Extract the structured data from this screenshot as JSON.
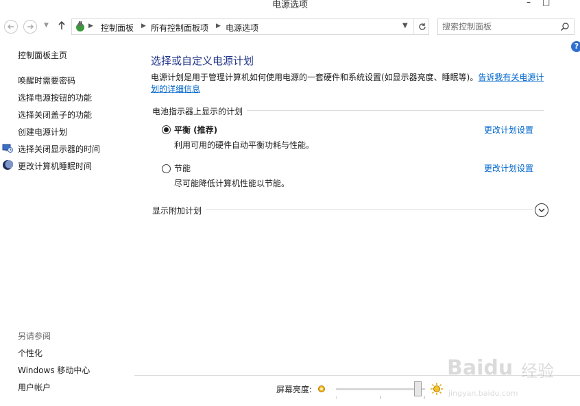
{
  "window": {
    "title": "电源选项",
    "minimize": "–",
    "maximize": "□"
  },
  "nav": {
    "breadcrumbs": [
      "控制面板",
      "所有控制面板项",
      "电源选项"
    ],
    "search_placeholder": "搜索控制面板"
  },
  "sidebar": {
    "home": "控制面板主页",
    "items": [
      {
        "label": "唤醒时需要密码",
        "icon": "none"
      },
      {
        "label": "选择电源按钮的功能",
        "icon": "none"
      },
      {
        "label": "选择关闭盖子的功能",
        "icon": "none"
      },
      {
        "label": "创建电源计划",
        "icon": "none"
      },
      {
        "label": "选择关闭显示器的时间",
        "icon": "monitor-clock-icon"
      },
      {
        "label": "更改计算机睡眠时间",
        "icon": "moon-icon"
      }
    ],
    "see_also_title": "另请参阅",
    "see_also": [
      "个性化",
      "Windows 移动中心",
      "用户帐户"
    ]
  },
  "main": {
    "title": "选择或自定义电源计划",
    "description": "电源计划是用于管理计算机如何使用电源的一套硬件和系统设置(如显示器亮度、睡眠等)。",
    "description_link": "告诉我有关电源计划的详细信息",
    "battery_group": "电池指示器上显示的计划",
    "plans": [
      {
        "name": "平衡 (推荐)",
        "description": "利用可用的硬件自动平衡功耗与性能。",
        "selected": true,
        "link": "更改计划设置"
      },
      {
        "name": "节能",
        "description": "尽可能降低计算机性能以节能。",
        "selected": false,
        "link": "更改计划设置"
      }
    ],
    "additional_plans": "显示附加计划"
  },
  "brightness": {
    "label": "屏幕亮度:",
    "level_percent": 92
  },
  "watermark": {
    "brand": "Baidu",
    "brand_cn": "经验",
    "url": "jingyan.baidu.com"
  },
  "colors": {
    "link": "#0066cc",
    "title": "#1e3287",
    "help": "#2f6fcf"
  }
}
